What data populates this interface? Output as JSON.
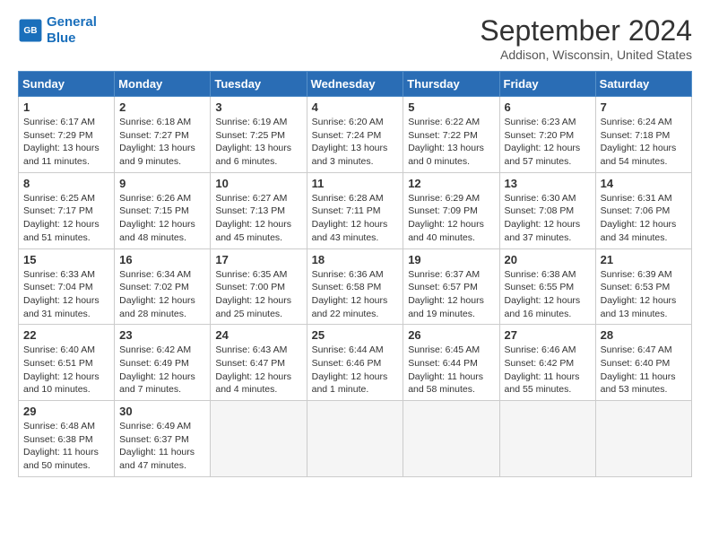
{
  "header": {
    "logo_line1": "General",
    "logo_line2": "Blue",
    "month_title": "September 2024",
    "location": "Addison, Wisconsin, United States"
  },
  "weekdays": [
    "Sunday",
    "Monday",
    "Tuesday",
    "Wednesday",
    "Thursday",
    "Friday",
    "Saturday"
  ],
  "weeks": [
    [
      {
        "day": "1",
        "text": "Sunrise: 6:17 AM\nSunset: 7:29 PM\nDaylight: 13 hours and 11 minutes."
      },
      {
        "day": "2",
        "text": "Sunrise: 6:18 AM\nSunset: 7:27 PM\nDaylight: 13 hours and 9 minutes."
      },
      {
        "day": "3",
        "text": "Sunrise: 6:19 AM\nSunset: 7:25 PM\nDaylight: 13 hours and 6 minutes."
      },
      {
        "day": "4",
        "text": "Sunrise: 6:20 AM\nSunset: 7:24 PM\nDaylight: 13 hours and 3 minutes."
      },
      {
        "day": "5",
        "text": "Sunrise: 6:22 AM\nSunset: 7:22 PM\nDaylight: 13 hours and 0 minutes."
      },
      {
        "day": "6",
        "text": "Sunrise: 6:23 AM\nSunset: 7:20 PM\nDaylight: 12 hours and 57 minutes."
      },
      {
        "day": "7",
        "text": "Sunrise: 6:24 AM\nSunset: 7:18 PM\nDaylight: 12 hours and 54 minutes."
      }
    ],
    [
      {
        "day": "8",
        "text": "Sunrise: 6:25 AM\nSunset: 7:17 PM\nDaylight: 12 hours and 51 minutes."
      },
      {
        "day": "9",
        "text": "Sunrise: 6:26 AM\nSunset: 7:15 PM\nDaylight: 12 hours and 48 minutes."
      },
      {
        "day": "10",
        "text": "Sunrise: 6:27 AM\nSunset: 7:13 PM\nDaylight: 12 hours and 45 minutes."
      },
      {
        "day": "11",
        "text": "Sunrise: 6:28 AM\nSunset: 7:11 PM\nDaylight: 12 hours and 43 minutes."
      },
      {
        "day": "12",
        "text": "Sunrise: 6:29 AM\nSunset: 7:09 PM\nDaylight: 12 hours and 40 minutes."
      },
      {
        "day": "13",
        "text": "Sunrise: 6:30 AM\nSunset: 7:08 PM\nDaylight: 12 hours and 37 minutes."
      },
      {
        "day": "14",
        "text": "Sunrise: 6:31 AM\nSunset: 7:06 PM\nDaylight: 12 hours and 34 minutes."
      }
    ],
    [
      {
        "day": "15",
        "text": "Sunrise: 6:33 AM\nSunset: 7:04 PM\nDaylight: 12 hours and 31 minutes."
      },
      {
        "day": "16",
        "text": "Sunrise: 6:34 AM\nSunset: 7:02 PM\nDaylight: 12 hours and 28 minutes."
      },
      {
        "day": "17",
        "text": "Sunrise: 6:35 AM\nSunset: 7:00 PM\nDaylight: 12 hours and 25 minutes."
      },
      {
        "day": "18",
        "text": "Sunrise: 6:36 AM\nSunset: 6:58 PM\nDaylight: 12 hours and 22 minutes."
      },
      {
        "day": "19",
        "text": "Sunrise: 6:37 AM\nSunset: 6:57 PM\nDaylight: 12 hours and 19 minutes."
      },
      {
        "day": "20",
        "text": "Sunrise: 6:38 AM\nSunset: 6:55 PM\nDaylight: 12 hours and 16 minutes."
      },
      {
        "day": "21",
        "text": "Sunrise: 6:39 AM\nSunset: 6:53 PM\nDaylight: 12 hours and 13 minutes."
      }
    ],
    [
      {
        "day": "22",
        "text": "Sunrise: 6:40 AM\nSunset: 6:51 PM\nDaylight: 12 hours and 10 minutes."
      },
      {
        "day": "23",
        "text": "Sunrise: 6:42 AM\nSunset: 6:49 PM\nDaylight: 12 hours and 7 minutes."
      },
      {
        "day": "24",
        "text": "Sunrise: 6:43 AM\nSunset: 6:47 PM\nDaylight: 12 hours and 4 minutes."
      },
      {
        "day": "25",
        "text": "Sunrise: 6:44 AM\nSunset: 6:46 PM\nDaylight: 12 hours and 1 minute."
      },
      {
        "day": "26",
        "text": "Sunrise: 6:45 AM\nSunset: 6:44 PM\nDaylight: 11 hours and 58 minutes."
      },
      {
        "day": "27",
        "text": "Sunrise: 6:46 AM\nSunset: 6:42 PM\nDaylight: 11 hours and 55 minutes."
      },
      {
        "day": "28",
        "text": "Sunrise: 6:47 AM\nSunset: 6:40 PM\nDaylight: 11 hours and 53 minutes."
      }
    ],
    [
      {
        "day": "29",
        "text": "Sunrise: 6:48 AM\nSunset: 6:38 PM\nDaylight: 11 hours and 50 minutes."
      },
      {
        "day": "30",
        "text": "Sunrise: 6:49 AM\nSunset: 6:37 PM\nDaylight: 11 hours and 47 minutes."
      },
      {
        "day": "",
        "text": "",
        "empty": true
      },
      {
        "day": "",
        "text": "",
        "empty": true
      },
      {
        "day": "",
        "text": "",
        "empty": true
      },
      {
        "day": "",
        "text": "",
        "empty": true
      },
      {
        "day": "",
        "text": "",
        "empty": true
      }
    ]
  ]
}
